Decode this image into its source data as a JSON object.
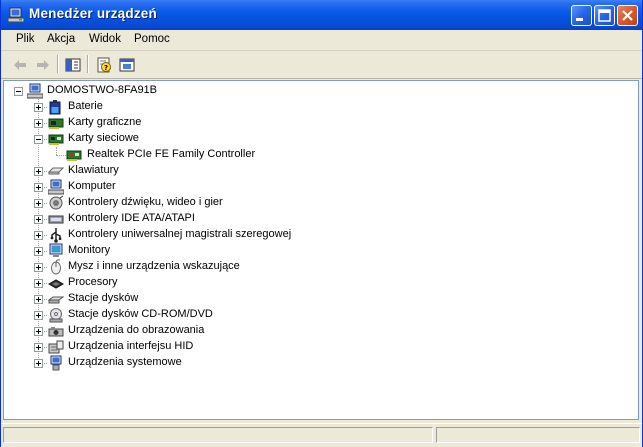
{
  "window": {
    "title": "Menedżer urządzeń"
  },
  "menu": [
    "Plik",
    "Akcja",
    "Widok",
    "Pomoc"
  ],
  "toolbar": [
    "back-icon",
    "forward-icon",
    "tree-view-icon",
    "properties-help-icon",
    "update-driver-icon"
  ],
  "tree": {
    "root": "DOMOSTWO-8FA91B",
    "items": [
      {
        "label": "Baterie",
        "icon": "battery-icon",
        "expanded": false
      },
      {
        "label": "Karty graficzne",
        "icon": "display-adapter-icon",
        "expanded": false
      },
      {
        "label": "Karty sieciowe",
        "icon": "network-adapter-icon",
        "expanded": true,
        "children": [
          {
            "label": "Realtek PCIe FE Family Controller",
            "icon": "network-card-icon"
          }
        ]
      },
      {
        "label": "Klawiatury",
        "icon": "keyboard-icon",
        "expanded": false
      },
      {
        "label": "Komputer",
        "icon": "computer-icon",
        "expanded": false
      },
      {
        "label": "Kontrolery dźwięku, wideo i gier",
        "icon": "sound-icon",
        "expanded": false
      },
      {
        "label": "Kontrolery IDE ATA/ATAPI",
        "icon": "ide-controller-icon",
        "expanded": false
      },
      {
        "label": "Kontrolery uniwersalnej magistrali szeregowej",
        "icon": "usb-icon",
        "expanded": false
      },
      {
        "label": "Monitory",
        "icon": "monitor-icon",
        "expanded": false
      },
      {
        "label": "Mysz i inne urządzenia wskazujące",
        "icon": "mouse-icon",
        "expanded": false
      },
      {
        "label": "Procesory",
        "icon": "processor-icon",
        "expanded": false
      },
      {
        "label": "Stacje dysków",
        "icon": "disk-drive-icon",
        "expanded": false
      },
      {
        "label": "Stacje dysków CD-ROM/DVD",
        "icon": "cdrom-icon",
        "expanded": false
      },
      {
        "label": "Urządzenia do obrazowania",
        "icon": "imaging-device-icon",
        "expanded": false
      },
      {
        "label": "Urządzenia interfejsu HID",
        "icon": "hid-icon",
        "expanded": false
      },
      {
        "label": "Urządzenia systemowe",
        "icon": "system-device-icon",
        "expanded": false
      }
    ]
  }
}
